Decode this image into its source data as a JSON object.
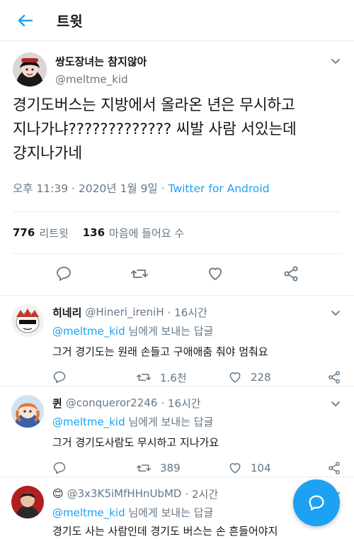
{
  "header": {
    "title": "트윗"
  },
  "tweet": {
    "author_name": "쌍도장녀는 참지않아",
    "author_handle": "@meltme_kid",
    "text": "경기도버스는 지방에서 올라온 년은 무시하고\n지나가냐????????????? 씨발 사람 서있는데\n걍지나가네",
    "timestamp": "오후 11:39 · 2020년 1월 9일 · ",
    "source": "Twitter for Android",
    "retweets": "776",
    "retweets_label": "리트윗",
    "likes": "136",
    "likes_label": "마음에 들어요 수"
  },
  "replies": [
    {
      "name": "히네리",
      "handle": "@Hineri_ireniH",
      "time": "· 16시간",
      "mention": "@meltme_kid",
      "to_label": " 님에게 보내는 답글",
      "text": "그거 경기도는 원래 손들고 구애애춤 춰야 멈춰요",
      "retweets": "1.6천",
      "likes": "228"
    },
    {
      "name": "퀸",
      "handle": "@conqueror2246",
      "time": "· 16시간",
      "mention": "@meltme_kid",
      "to_label": " 님에게 보내는 답글",
      "text": "그거 경기도사람도 무시하고 지나가요",
      "retweets": "389",
      "likes": "104"
    },
    {
      "name": "😊",
      "handle": "@3x3K5iMfHHnUbMD",
      "time": "· 2시간",
      "mention": "@meltme_kid",
      "to_label": " 님에게 보내는 답글",
      "text": "경기도 사는 사람인데 경기도 버스는 손 흔들어야지\n니다. 안 흔들면 안타는 줄 알고 그냥 지나가요. 그리고 경기"
    }
  ],
  "colors": {
    "accent": "#1da1f2",
    "muted": "#657786",
    "text": "#14171a",
    "divider": "#e6ecf0"
  },
  "icons": [
    "back-arrow-icon",
    "chevron-down-icon",
    "reply-icon",
    "retweet-icon",
    "heart-icon",
    "share-icon",
    "compose-reply-icon"
  ]
}
